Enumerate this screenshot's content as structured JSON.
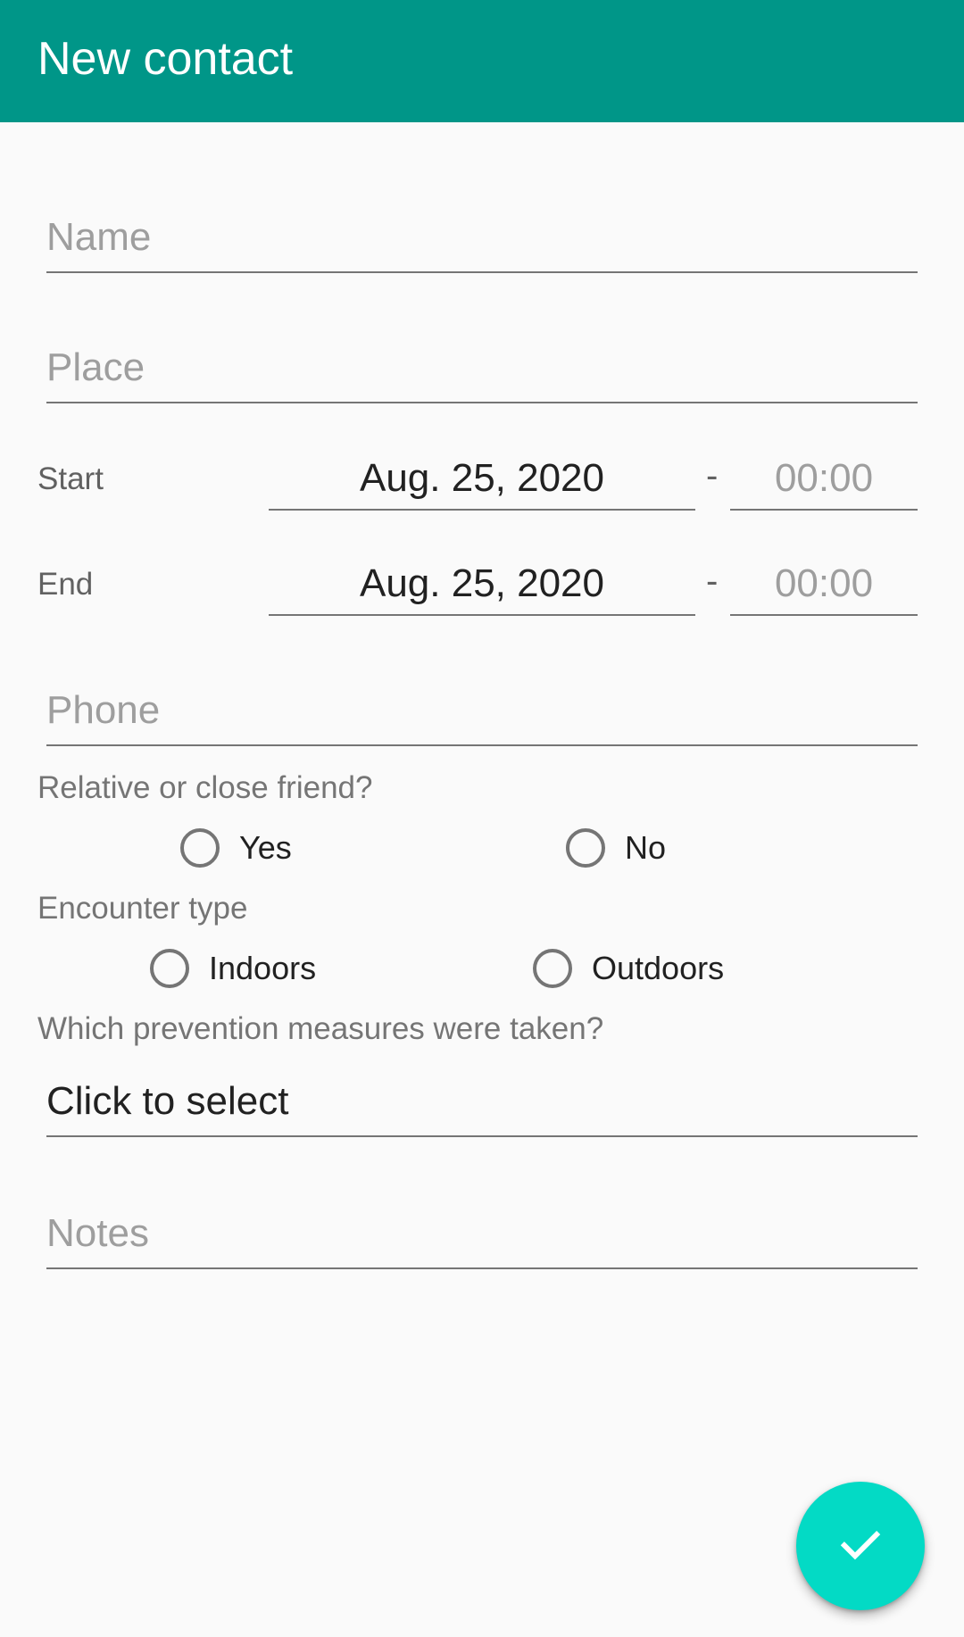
{
  "appbar": {
    "title": "New contact"
  },
  "form": {
    "name_placeholder": "Name",
    "place_placeholder": "Place",
    "start": {
      "label": "Start",
      "date": "Aug. 25, 2020",
      "separator": "-",
      "time_placeholder": "00:00"
    },
    "end": {
      "label": "End",
      "date": "Aug. 25, 2020",
      "separator": "-",
      "time_placeholder": "00:00"
    },
    "phone_placeholder": "Phone",
    "relative": {
      "question": "Relative or close friend?",
      "option_yes": "Yes",
      "option_no": "No"
    },
    "encounter": {
      "question": "Encounter type",
      "option_indoors": "Indoors",
      "option_outdoors": "Outdoors"
    },
    "prevention": {
      "question": "Which prevention measures were taken?",
      "value": "Click to select"
    },
    "notes_placeholder": "Notes"
  },
  "fab": {
    "icon": "check-icon",
    "color": "#03dac5"
  },
  "colors": {
    "primary": "#009688",
    "accent": "#03dac5"
  }
}
